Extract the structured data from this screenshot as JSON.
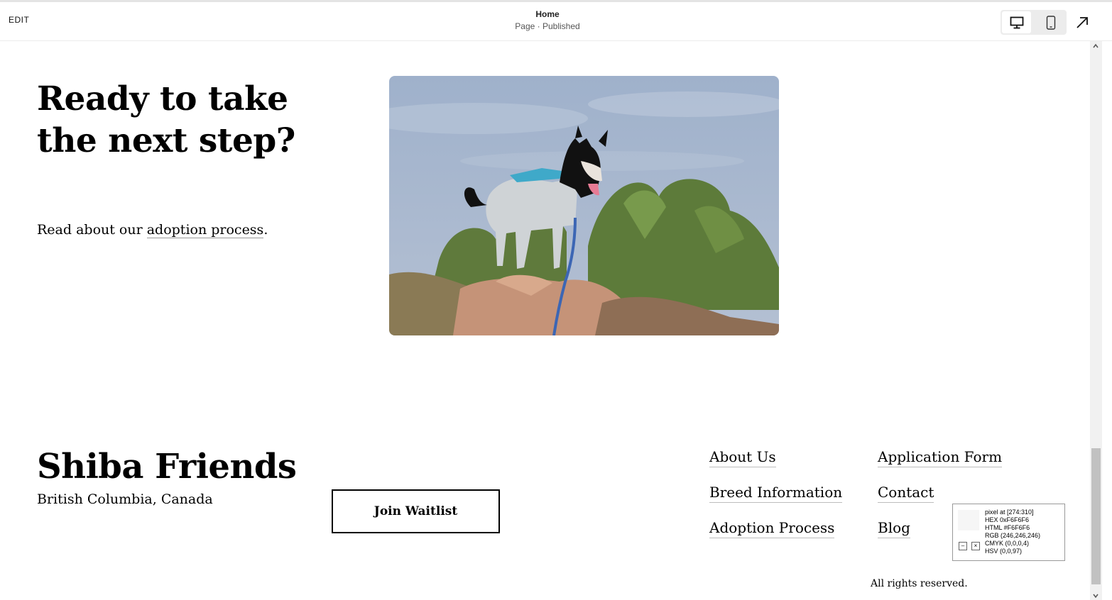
{
  "topbar": {
    "edit_label": "EDIT",
    "page_title": "Home",
    "page_status": "Page · Published"
  },
  "hero": {
    "headline_line1": "Ready to take",
    "headline_line2": "the next step?",
    "lead_prefix": "Read about our ",
    "lead_link": "adoption process",
    "lead_suffix": "."
  },
  "footer": {
    "brand": "Shiba Friends",
    "location": "British Columbia, Canada",
    "cta_label": "Join Waitlist",
    "nav": [
      "About Us",
      "Breed Information",
      "Adoption Process",
      "Application Form",
      "Contact",
      "Blog"
    ],
    "rights": "All rights reserved."
  },
  "color_picker": {
    "pixel": "pixel at [274:310]",
    "hex": "HEX 0xF6F6F6",
    "html": "HTML #F6F6F6",
    "rgb": "RGB (246,246,246)",
    "cmyk": "CMYK (0,0,0,4)",
    "hsv": "HSV (0,0,97)",
    "swatch_color": "#F6F6F6"
  },
  "icons": {
    "desktop": "desktop-icon",
    "mobile": "mobile-icon",
    "open": "arrow-up-right-icon"
  }
}
